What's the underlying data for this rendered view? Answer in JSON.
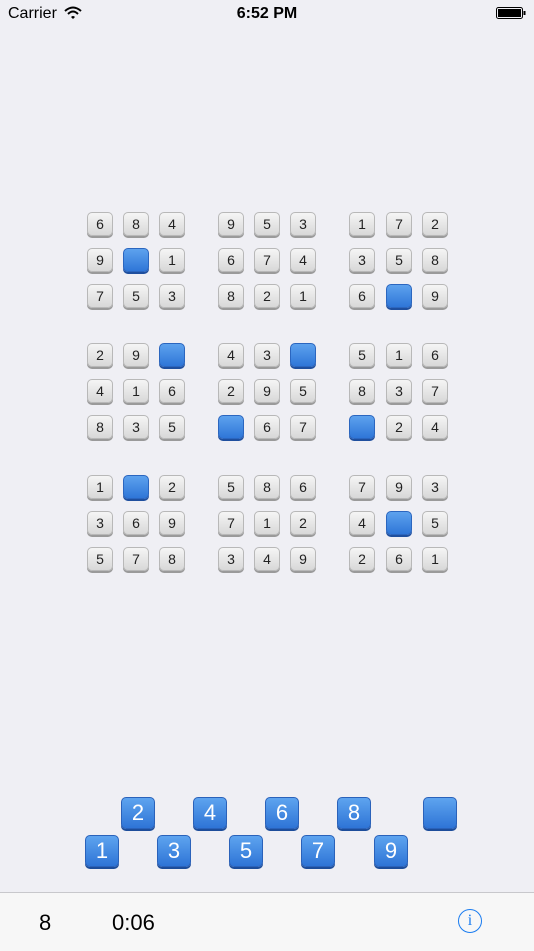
{
  "status_bar": {
    "carrier": "Carrier",
    "time": "6:52 PM"
  },
  "board": {
    "rows": [
      [
        "6",
        "8",
        "4",
        "9",
        "5",
        "3",
        "1",
        "7",
        "2"
      ],
      [
        "9",
        "",
        "1",
        "6",
        "7",
        "4",
        "3",
        "5",
        "8"
      ],
      [
        "7",
        "5",
        "3",
        "8",
        "2",
        "1",
        "6",
        "",
        "9"
      ],
      [
        "2",
        "9",
        "",
        "4",
        "3",
        "",
        "5",
        "1",
        "6"
      ],
      [
        "4",
        "1",
        "6",
        "2",
        "9",
        "5",
        "8",
        "3",
        "7"
      ],
      [
        "8",
        "3",
        "5",
        "",
        "6",
        "7",
        "",
        "2",
        "4"
      ],
      [
        "1",
        "",
        "2",
        "5",
        "8",
        "6",
        "7",
        "9",
        "3"
      ],
      [
        "3",
        "6",
        "9",
        "7",
        "1",
        "2",
        "4",
        "",
        "5"
      ],
      [
        "5",
        "7",
        "8",
        "3",
        "4",
        "9",
        "2",
        "6",
        "1"
      ]
    ]
  },
  "palette": {
    "keys": [
      "1",
      "2",
      "3",
      "4",
      "5",
      "6",
      "7",
      "8",
      "9",
      ""
    ]
  },
  "toolbar": {
    "remaining": "8",
    "timer": "0:06",
    "info_label": "i"
  },
  "colors": {
    "background": "#efeff4",
    "accent_blue": "#2f76d8",
    "info_blue": "#1a7cf0"
  }
}
